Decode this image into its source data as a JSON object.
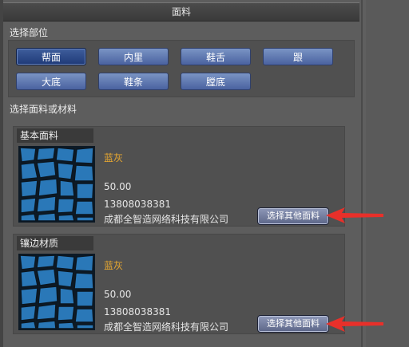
{
  "header": {
    "title": "面料"
  },
  "parts": {
    "label": "选择部位",
    "buttons": [
      {
        "label": "帮面",
        "active": true
      },
      {
        "label": "内里",
        "active": false
      },
      {
        "label": "鞋舌",
        "active": false
      },
      {
        "label": "跟",
        "active": false
      },
      {
        "label": "大底",
        "active": false
      },
      {
        "label": "鞋条",
        "active": false
      },
      {
        "label": "膛底",
        "active": false
      }
    ]
  },
  "materials": {
    "label": "选择面料或材料",
    "cards": [
      {
        "title": "基本面料",
        "color_name": "蓝灰",
        "price": "50.00",
        "phone": "13808038381",
        "company": "成都全智造网络科技有限公司",
        "button_label": "选择其他面料"
      },
      {
        "title": "镶边材质",
        "color_name": "蓝灰",
        "price": "50.00",
        "phone": "13808038381",
        "company": "成都全智造网络科技有限公司",
        "button_label": "选择其他面料"
      }
    ]
  },
  "colors": {
    "accent_orange": "#e8a830",
    "button_blue": "#4a62a0",
    "arrow_red": "#e8302a",
    "swatch_blue": "#1f6aa8"
  }
}
